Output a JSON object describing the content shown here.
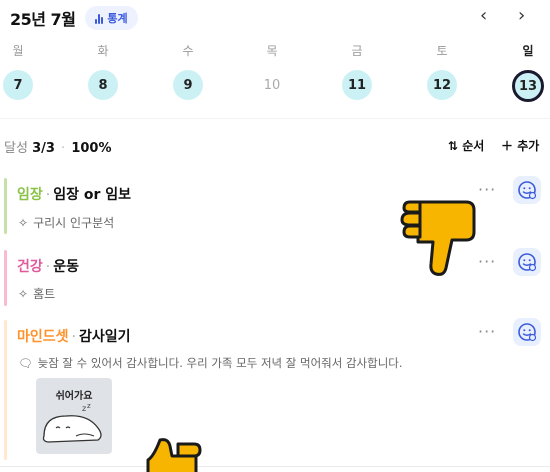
{
  "header": {
    "month": "25년 7월",
    "stats_label": "통계",
    "prev_icon": "chevron-left-icon",
    "next_icon": "chevron-right-icon"
  },
  "week": [
    {
      "weekday": "월",
      "date": "7",
      "done": true
    },
    {
      "weekday": "화",
      "date": "8",
      "done": true
    },
    {
      "weekday": "수",
      "date": "9",
      "done": true
    },
    {
      "weekday": "목",
      "date": "10",
      "done": false
    },
    {
      "weekday": "금",
      "date": "11",
      "done": true
    },
    {
      "weekday": "토",
      "date": "12",
      "done": true
    },
    {
      "weekday": "일",
      "date": "13",
      "done": true,
      "today": true
    }
  ],
  "progress": {
    "label": "달성",
    "count": "3/3",
    "percent": "100%"
  },
  "toolbar": {
    "order_label": "순서",
    "add_label": "추가"
  },
  "habits": [
    {
      "category": "임장",
      "name": "임장 or 임보",
      "detail": "구리시 인구분석",
      "color": "#8bc34a"
    },
    {
      "category": "건강",
      "name": "운동",
      "detail": "홈트",
      "color": "#e05a9c"
    },
    {
      "category": "마인드셋",
      "name": "감사일기",
      "detail": "늦잠 잘 수 있어서 감사합니다. 우리 가족 모두 저녁 잘 먹어줘서 감사합니다.",
      "color": "#ff922b"
    }
  ],
  "sticker": {
    "text": "쉬어가요"
  },
  "colors": {
    "done_day": "#ccf1f5",
    "accent": "#3b5bdb",
    "face_button_bg": "#e8efff"
  }
}
